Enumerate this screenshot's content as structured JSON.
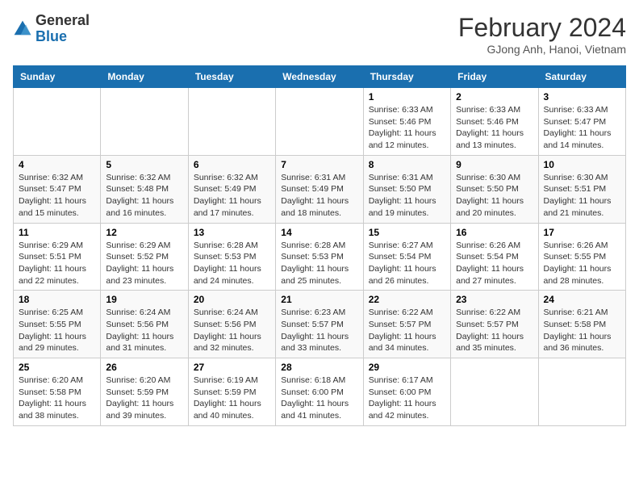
{
  "header": {
    "logo_general": "General",
    "logo_blue": "Blue",
    "month_title": "February 2024",
    "location": "GJong Anh, Hanoi, Vietnam"
  },
  "weekdays": [
    "Sunday",
    "Monday",
    "Tuesday",
    "Wednesday",
    "Thursday",
    "Friday",
    "Saturday"
  ],
  "weeks": [
    [
      {
        "day": "",
        "info": ""
      },
      {
        "day": "",
        "info": ""
      },
      {
        "day": "",
        "info": ""
      },
      {
        "day": "",
        "info": ""
      },
      {
        "day": "1",
        "info": "Sunrise: 6:33 AM\nSunset: 5:46 PM\nDaylight: 11 hours and 12 minutes."
      },
      {
        "day": "2",
        "info": "Sunrise: 6:33 AM\nSunset: 5:46 PM\nDaylight: 11 hours and 13 minutes."
      },
      {
        "day": "3",
        "info": "Sunrise: 6:33 AM\nSunset: 5:47 PM\nDaylight: 11 hours and 14 minutes."
      }
    ],
    [
      {
        "day": "4",
        "info": "Sunrise: 6:32 AM\nSunset: 5:47 PM\nDaylight: 11 hours and 15 minutes."
      },
      {
        "day": "5",
        "info": "Sunrise: 6:32 AM\nSunset: 5:48 PM\nDaylight: 11 hours and 16 minutes."
      },
      {
        "day": "6",
        "info": "Sunrise: 6:32 AM\nSunset: 5:49 PM\nDaylight: 11 hours and 17 minutes."
      },
      {
        "day": "7",
        "info": "Sunrise: 6:31 AM\nSunset: 5:49 PM\nDaylight: 11 hours and 18 minutes."
      },
      {
        "day": "8",
        "info": "Sunrise: 6:31 AM\nSunset: 5:50 PM\nDaylight: 11 hours and 19 minutes."
      },
      {
        "day": "9",
        "info": "Sunrise: 6:30 AM\nSunset: 5:50 PM\nDaylight: 11 hours and 20 minutes."
      },
      {
        "day": "10",
        "info": "Sunrise: 6:30 AM\nSunset: 5:51 PM\nDaylight: 11 hours and 21 minutes."
      }
    ],
    [
      {
        "day": "11",
        "info": "Sunrise: 6:29 AM\nSunset: 5:51 PM\nDaylight: 11 hours and 22 minutes."
      },
      {
        "day": "12",
        "info": "Sunrise: 6:29 AM\nSunset: 5:52 PM\nDaylight: 11 hours and 23 minutes."
      },
      {
        "day": "13",
        "info": "Sunrise: 6:28 AM\nSunset: 5:53 PM\nDaylight: 11 hours and 24 minutes."
      },
      {
        "day": "14",
        "info": "Sunrise: 6:28 AM\nSunset: 5:53 PM\nDaylight: 11 hours and 25 minutes."
      },
      {
        "day": "15",
        "info": "Sunrise: 6:27 AM\nSunset: 5:54 PM\nDaylight: 11 hours and 26 minutes."
      },
      {
        "day": "16",
        "info": "Sunrise: 6:26 AM\nSunset: 5:54 PM\nDaylight: 11 hours and 27 minutes."
      },
      {
        "day": "17",
        "info": "Sunrise: 6:26 AM\nSunset: 5:55 PM\nDaylight: 11 hours and 28 minutes."
      }
    ],
    [
      {
        "day": "18",
        "info": "Sunrise: 6:25 AM\nSunset: 5:55 PM\nDaylight: 11 hours and 29 minutes."
      },
      {
        "day": "19",
        "info": "Sunrise: 6:24 AM\nSunset: 5:56 PM\nDaylight: 11 hours and 31 minutes."
      },
      {
        "day": "20",
        "info": "Sunrise: 6:24 AM\nSunset: 5:56 PM\nDaylight: 11 hours and 32 minutes."
      },
      {
        "day": "21",
        "info": "Sunrise: 6:23 AM\nSunset: 5:57 PM\nDaylight: 11 hours and 33 minutes."
      },
      {
        "day": "22",
        "info": "Sunrise: 6:22 AM\nSunset: 5:57 PM\nDaylight: 11 hours and 34 minutes."
      },
      {
        "day": "23",
        "info": "Sunrise: 6:22 AM\nSunset: 5:57 PM\nDaylight: 11 hours and 35 minutes."
      },
      {
        "day": "24",
        "info": "Sunrise: 6:21 AM\nSunset: 5:58 PM\nDaylight: 11 hours and 36 minutes."
      }
    ],
    [
      {
        "day": "25",
        "info": "Sunrise: 6:20 AM\nSunset: 5:58 PM\nDaylight: 11 hours and 38 minutes."
      },
      {
        "day": "26",
        "info": "Sunrise: 6:20 AM\nSunset: 5:59 PM\nDaylight: 11 hours and 39 minutes."
      },
      {
        "day": "27",
        "info": "Sunrise: 6:19 AM\nSunset: 5:59 PM\nDaylight: 11 hours and 40 minutes."
      },
      {
        "day": "28",
        "info": "Sunrise: 6:18 AM\nSunset: 6:00 PM\nDaylight: 11 hours and 41 minutes."
      },
      {
        "day": "29",
        "info": "Sunrise: 6:17 AM\nSunset: 6:00 PM\nDaylight: 11 hours and 42 minutes."
      },
      {
        "day": "",
        "info": ""
      },
      {
        "day": "",
        "info": ""
      }
    ]
  ],
  "colors": {
    "header_bg": "#1a6faf",
    "header_text": "#ffffff",
    "border": "#cccccc"
  }
}
